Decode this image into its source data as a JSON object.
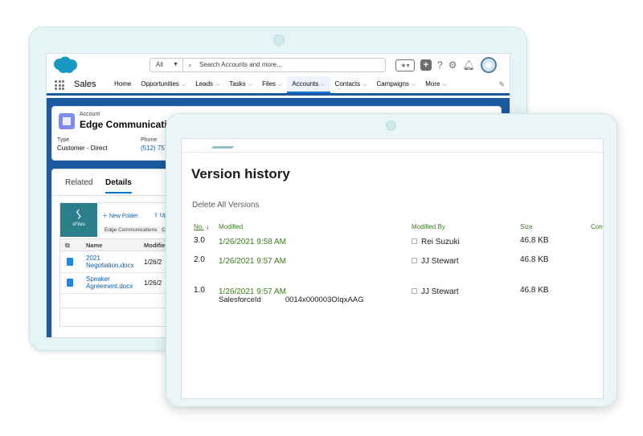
{
  "colors": {
    "salesforce_blue": "#1b5a9e",
    "link_blue": "#0b5cab",
    "version_green": "#3c7a1e",
    "sfiles_teal": "#2a7f8a",
    "tablet_frame": "#e6f4f5"
  },
  "salesforce": {
    "header": {
      "scope": "All",
      "search_placeholder": "Search Accounts and more...",
      "icons": [
        "salesforce-cloud-icon",
        "search-icon",
        "favorites-star-icon",
        "plus-icon",
        "help-icon",
        "setup-gear-icon",
        "bell-icon",
        "user-avatar-icon"
      ],
      "help_glyph": "?"
    },
    "nav": {
      "app_name": "Sales",
      "items": [
        {
          "label": "Home",
          "chevron": false,
          "active": false
        },
        {
          "label": "Opportunities",
          "chevron": true,
          "active": false
        },
        {
          "label": "Leads",
          "chevron": true,
          "active": false
        },
        {
          "label": "Tasks",
          "chevron": true,
          "active": false
        },
        {
          "label": "Files",
          "chevron": true,
          "active": false
        },
        {
          "label": "Accounts",
          "chevron": true,
          "active": true
        },
        {
          "label": "Contacts",
          "chevron": true,
          "active": false
        },
        {
          "label": "Campaigns",
          "chevron": true,
          "active": false
        },
        {
          "label": "More",
          "chevron": true,
          "active": false
        }
      ]
    },
    "record": {
      "object_type": "Account",
      "name": "Edge Communications",
      "fields": [
        {
          "label": "Type",
          "value": "Customer - Direct",
          "link": false
        },
        {
          "label": "Phone",
          "value": "(512) 757",
          "link": true
        }
      ]
    },
    "tabs": [
      {
        "label": "Related",
        "active": false
      },
      {
        "label": "Details",
        "active": true
      }
    ],
    "sfiles": {
      "logo_text": "sFiles",
      "new_folder": "New Folder",
      "upload": "Up",
      "breadcrumb": "Edge Communications",
      "breadcrumb_next": "C",
      "columns": {
        "name": "Name",
        "modified": "Modifie"
      },
      "files": [
        {
          "name": "2021 Negotiation.docx",
          "modified": "1/26/2"
        },
        {
          "name": "Speaker Agreement.docx",
          "modified": "1/26/2"
        }
      ]
    }
  },
  "version_history": {
    "title": "Version history",
    "delete_all": "Delete All Versions",
    "columns": {
      "no": "No.",
      "modified": "Modified",
      "modified_by": "Modified By",
      "size": "Size",
      "comments": "Con"
    },
    "sort_indicator": "↓",
    "rows": [
      {
        "no": "3.0",
        "modified": "1/26/2021 9:58 AM",
        "modified_by": "Rei Suzuki",
        "size": "46.8 KB"
      },
      {
        "no": "2.0",
        "modified": "1/26/2021 9:57 AM",
        "modified_by": "JJ Stewart",
        "size": "46.8 KB"
      },
      {
        "no": "1.0",
        "modified": "1/26/2021 9:57 AM",
        "modified_by": "JJ Stewart",
        "size": "46.8 KB"
      }
    ],
    "extra_property": {
      "label": "SalesforceId",
      "value": "0014x000003OIqxAAG"
    }
  }
}
